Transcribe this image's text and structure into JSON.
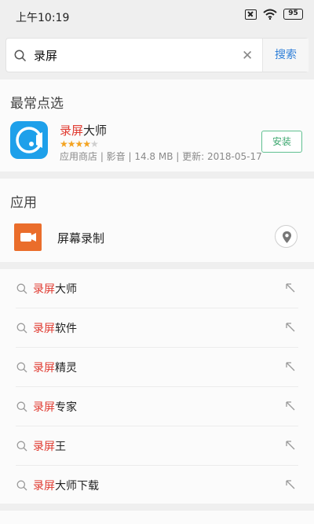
{
  "status_bar": {
    "time": "上午10:19",
    "battery": "95"
  },
  "search": {
    "query": "录屏",
    "clear_glyph": "✕",
    "button_label": "搜索"
  },
  "top_picks": {
    "title": "最常点选",
    "app": {
      "name_highlight": "录屏",
      "name_rest": "大师",
      "rating": 4,
      "rating_max": 5,
      "meta": "应用商店 | 影音 | 14.8 MB | 更新: 2018-05-17",
      "install_label": "安装",
      "icon_color": "#1ea0ea"
    }
  },
  "apps": {
    "title": "应用",
    "item": {
      "name": "屏幕录制",
      "icon_color": "#ea6d2b"
    }
  },
  "suggestions": [
    {
      "highlight": "录屏",
      "rest": "大师"
    },
    {
      "highlight": "录屏",
      "rest": "软件"
    },
    {
      "highlight": "录屏",
      "rest": "精灵"
    },
    {
      "highlight": "录屏",
      "rest": "专家"
    },
    {
      "highlight": "录屏",
      "rest": "王"
    },
    {
      "highlight": "录屏",
      "rest": "大师下载"
    }
  ],
  "colors": {
    "highlight": "#e0392f",
    "search_button": "#2f7fd8",
    "install": "#3ea870",
    "star": "#f3a321"
  }
}
